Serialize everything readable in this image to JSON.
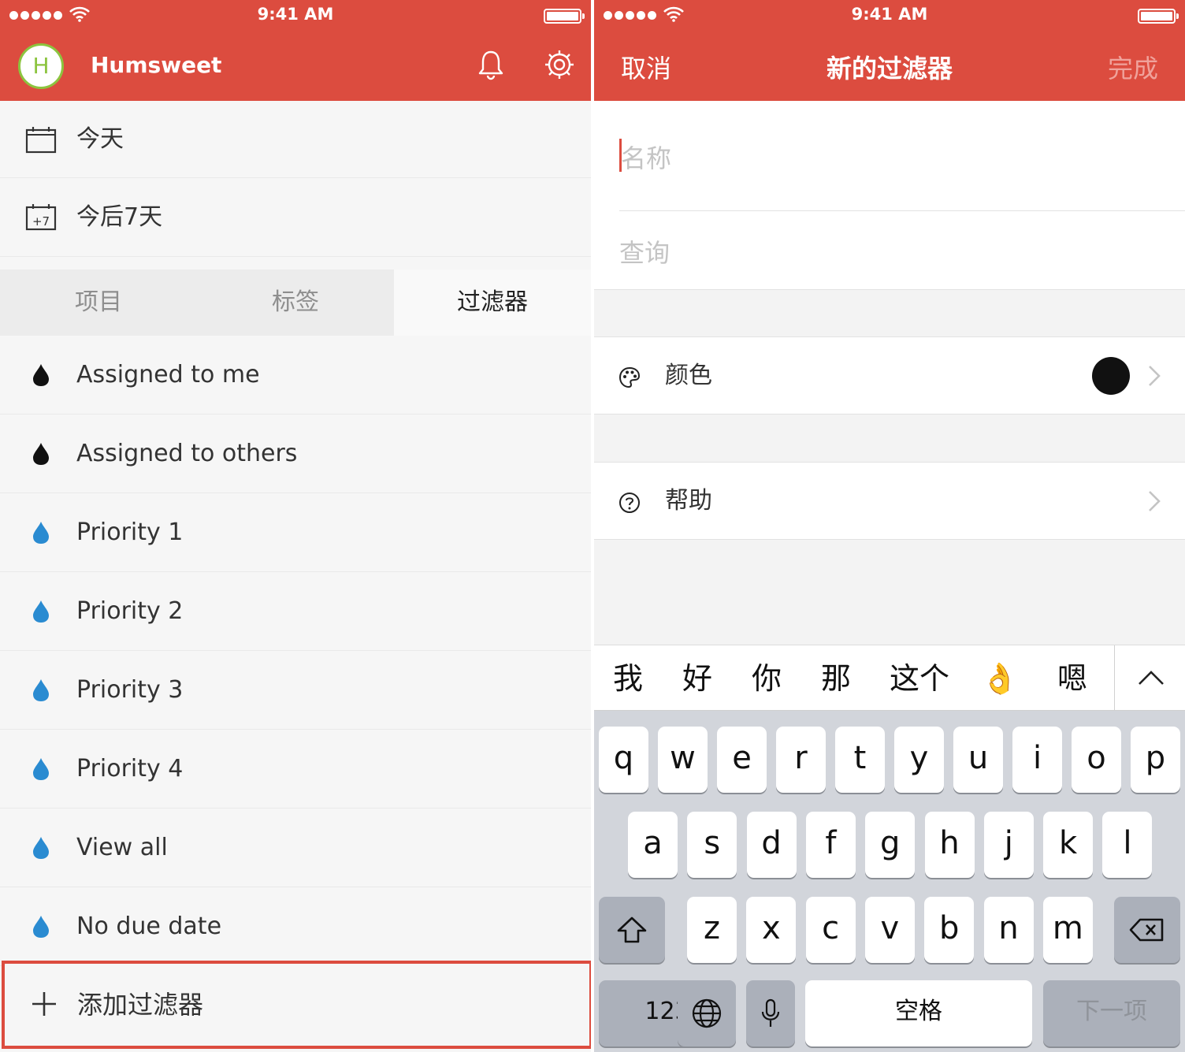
{
  "status": {
    "time": "9:41 AM"
  },
  "left": {
    "username": "Humsweet",
    "avatar_letter": "H",
    "nav_items": [
      {
        "label": "今天",
        "icon": "calendar-icon"
      },
      {
        "label": "今后7天",
        "icon": "calendar-plus7-icon",
        "badge": "+7"
      }
    ],
    "tabs": [
      {
        "label": "项目"
      },
      {
        "label": "标签"
      },
      {
        "label": "过滤器",
        "active": true
      }
    ],
    "filters": [
      {
        "label": "Assigned to me",
        "color": "#111111"
      },
      {
        "label": "Assigned to others",
        "color": "#111111"
      },
      {
        "label": "Priority 1",
        "color": "#2a8bd1"
      },
      {
        "label": "Priority 2",
        "color": "#2a8bd1"
      },
      {
        "label": "Priority 3",
        "color": "#2a8bd1"
      },
      {
        "label": "Priority 4",
        "color": "#2a8bd1"
      },
      {
        "label": "View all",
        "color": "#2a8bd1"
      },
      {
        "label": "No due date",
        "color": "#2a8bd1"
      }
    ],
    "add_filter_label": "添加过滤器"
  },
  "right": {
    "cancel_label": "取消",
    "title": "新的过滤器",
    "done_label": "完成",
    "name_placeholder": "名称",
    "query_placeholder": "查询",
    "color_label": "颜色",
    "color_value": "#111111",
    "help_label": "帮助",
    "candidates": [
      "我",
      "好",
      "你",
      "那",
      "这个",
      "👌",
      "嗯"
    ],
    "keyboard": {
      "row1": [
        "q",
        "w",
        "e",
        "r",
        "t",
        "y",
        "u",
        "i",
        "o",
        "p"
      ],
      "row2": [
        "a",
        "s",
        "d",
        "f",
        "g",
        "h",
        "j",
        "k",
        "l"
      ],
      "row3": [
        "z",
        "x",
        "c",
        "v",
        "b",
        "n",
        "m"
      ],
      "numbers_label": "123",
      "space_label": "空格",
      "next_label": "下一项"
    }
  },
  "colors": {
    "accent": "#dc4c3f",
    "avatar_ring": "#8cc43f",
    "priority_blue": "#2a8bd1"
  }
}
